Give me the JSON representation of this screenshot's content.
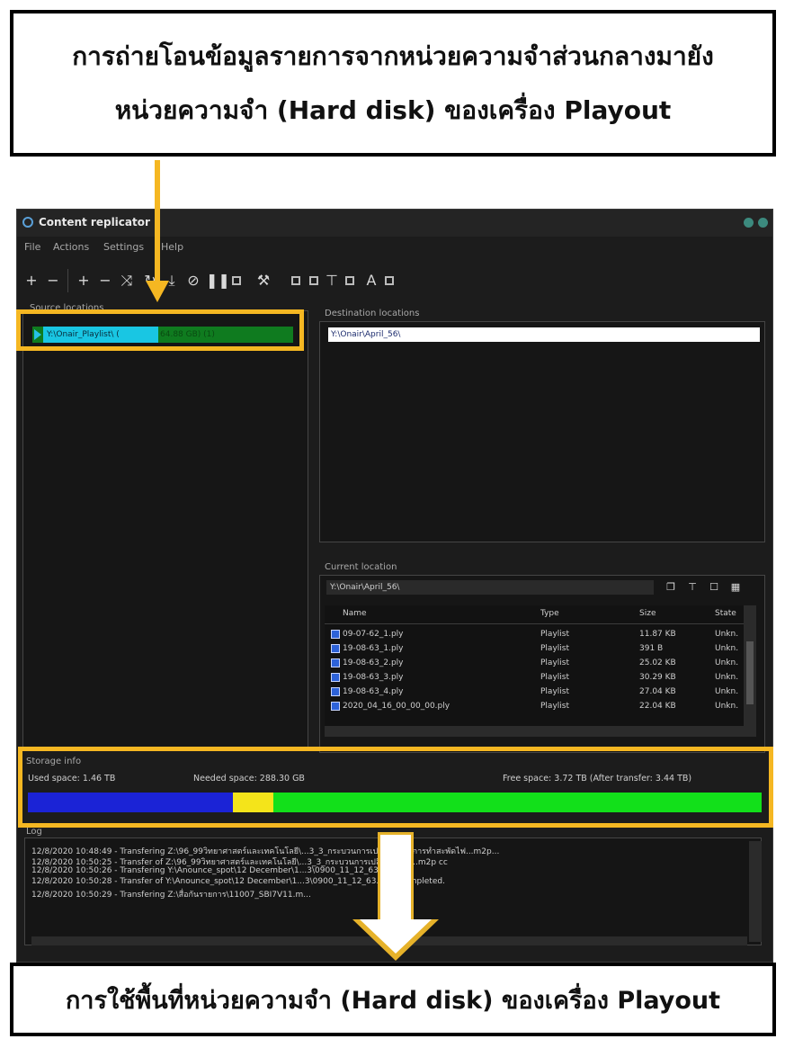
{
  "callouts": {
    "top_line1": "การถ่ายโอนข้อมูลรายการจากหน่วยความจำส่วนกลางมายัง",
    "top_line2": "หน่วยความจำ (Hard disk) ของเครื่อง Playout",
    "bottom": "การใช้พื้นที่หน่วยความจำ (Hard disk) ของเครื่อง Playout"
  },
  "window": {
    "title": "Content replicator",
    "menu": [
      "File",
      "Actions",
      "Settings",
      "Help"
    ]
  },
  "source": {
    "label": "Source locations",
    "path": "Y:\\Onair_Playlist\\ (",
    "info": "64.88 GB) (1)"
  },
  "destination": {
    "label": "Destination locations",
    "path": "Y:\\Onair\\April_56\\"
  },
  "current": {
    "label": "Current location",
    "path": "Y:\\Onair\\April_56\\",
    "columns": [
      "Name",
      "Type",
      "Size",
      "State"
    ],
    "rows": [
      {
        "name": "09-07-62_1.ply",
        "type": "Playlist",
        "size": "11.87 KB",
        "state": "Unkn."
      },
      {
        "name": "19-08-63_1.ply",
        "type": "Playlist",
        "size": "391 B",
        "state": "Unkn."
      },
      {
        "name": "19-08-63_2.ply",
        "type": "Playlist",
        "size": "25.02 KB",
        "state": "Unkn."
      },
      {
        "name": "19-08-63_3.ply",
        "type": "Playlist",
        "size": "30.29 KB",
        "state": "Unkn."
      },
      {
        "name": "19-08-63_4.ply",
        "type": "Playlist",
        "size": "27.04 KB",
        "state": "Unkn."
      },
      {
        "name": "2020_04_16_00_00_00.ply",
        "type": "Playlist",
        "size": "22.04 KB",
        "state": "Unkn."
      }
    ]
  },
  "storage": {
    "label": "Storage info",
    "used": "Used space: 1.46 TB",
    "needed": "Needed space: 288.30 GB",
    "free": "Free space: 3.72 TB (After transfer: 3.44 TB)",
    "used_fraction": 0.28,
    "needed_fraction": 0.055,
    "colors": {
      "used": "#1b23d6",
      "needed": "#f4e41a",
      "free": "#12e01a"
    }
  },
  "log": {
    "label": "Log",
    "lines": [
      "12/8/2020 10:48:49 - Transfering Z:\\96_99วิทยาศาสตร์และเทคโนโลยี\\...3_3_กระบวนการเปลี่ยนแปลงการทำสะพัดไฟ...m2p...",
      "12/8/2020 10:50:25 - Transfer of Z:\\96_99วิทยาศาสตร์และเทคโนโลยี\\...3_3_กระบวนการเปลี่ยนแปลง...m2p cc",
      "12/8/2020 10:50:26 - Transfering Y:\\Anounce_spot\\12 December\\1...3\\0900_11_12_63.mpg...",
      "12/8/2020 10:50:28 - Transfer of Y:\\Anounce_spot\\12 December\\1...3\\0900_11_12_63.mpg completed.",
      "12/8/2020 10:50:29 - Transfering Z:\\สื่อกันรายการ\\11007_SBI7V11.m..."
    ]
  },
  "highlight_color": "#f5b722"
}
